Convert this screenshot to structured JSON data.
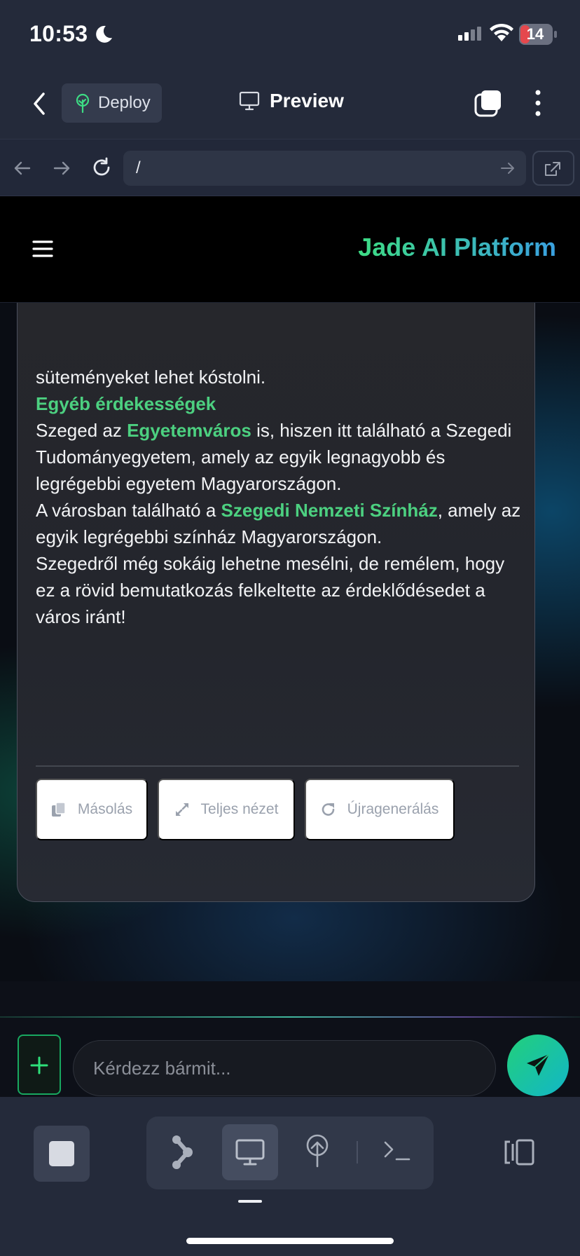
{
  "status_bar": {
    "time": "10:53",
    "battery": "14",
    "icons": [
      "moon-icon",
      "signal-icon",
      "wifi-icon",
      "battery-icon"
    ]
  },
  "toolbar": {
    "deploy_label": "Deploy",
    "title": "Preview",
    "icons": [
      "back-icon",
      "tree-icon",
      "monitor-icon",
      "tabs-icon",
      "more-vertical-icon"
    ]
  },
  "browser": {
    "url": "/",
    "icons": [
      "arrow-left-icon",
      "arrow-right-icon",
      "reload-icon",
      "url-go-icon",
      "external-link-icon"
    ]
  },
  "site": {
    "brand": "Jade AI Platform",
    "menu_icon": "hamburger-icon"
  },
  "message": {
    "p0": {
      "t0": "süteményeket lehet kóstolni."
    },
    "p1": {
      "h0": "Egyéb érdekességek"
    },
    "p2": {
      "t0": "Szeged az ",
      "h0": "Egyetemváros",
      "t1": " is, hiszen itt található a Szegedi Tudományegyetem, amely az egyik legnagyobb és legrégebbi egyetem Magyarországon."
    },
    "p3": {
      "t0": "A városban található a ",
      "h0": "Szegedi Nemzeti Színház",
      "t1": ", amely az egyik legrégebbi színház Magyarországon."
    },
    "p4": {
      "t0": "Szegedről még sokáig lehetne mesélni, de remélem, hogy ez a rövid bemutatkozás felkeltette az érdeklődésedet a város iránt!"
    }
  },
  "actions": {
    "copy": "Másolás",
    "fullscreen": "Teljes nézet",
    "regenerate": "Újragenerálás"
  },
  "composer": {
    "placeholder": "Kérdezz bármit..."
  },
  "bottom_bar": {
    "icons": [
      "stop-icon",
      "agent-icon",
      "monitor-icon",
      "deploy-icon",
      "terminal-icon",
      "sidebar-toggle-icon"
    ]
  },
  "colors": {
    "accent_green": "#4cd080",
    "brand_gradient_start": "#3ddc84",
    "brand_gradient_end": "#3aa0e0",
    "battery_low": "#e5484d"
  }
}
